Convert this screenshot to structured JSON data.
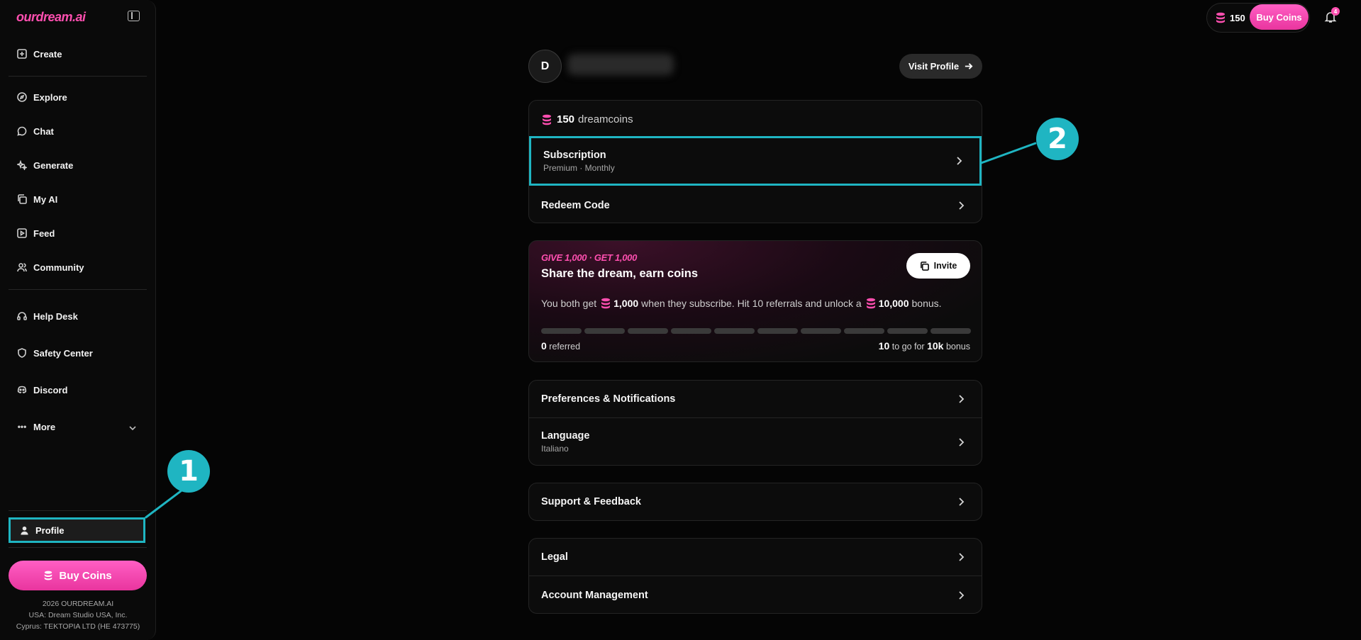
{
  "app": {
    "logo": "ourdream.ai"
  },
  "sidebar": {
    "items": [
      {
        "label": "Create"
      },
      {
        "label": "Explore"
      },
      {
        "label": "Chat"
      },
      {
        "label": "Generate"
      },
      {
        "label": "My AI"
      },
      {
        "label": "Feed"
      },
      {
        "label": "Community"
      },
      {
        "label": "Help Desk"
      },
      {
        "label": "Safety Center"
      },
      {
        "label": "Discord"
      },
      {
        "label": "More"
      }
    ],
    "profile_label": "Profile",
    "buy_coins_label": "Buy Coins",
    "footer": [
      "2026 OURDREAM.AI",
      "USA: Dream Studio USA, Inc.",
      "Cyprus: TEKTOPIA LTD (HE 473775)"
    ]
  },
  "topbar": {
    "coins": "150",
    "buy_coins_label": "Buy Coins",
    "notification_count": "4"
  },
  "profile": {
    "avatar_initial": "D",
    "visit_profile_label": "Visit Profile"
  },
  "account_card": {
    "coins_value": "150",
    "coins_unit": "dreamcoins",
    "subscription_title": "Subscription",
    "subscription_detail": "Premium · Monthly",
    "redeem_label": "Redeem Code"
  },
  "invite": {
    "promo": "GIVE 1,000 · GET 1,000",
    "title": "Share the dream, earn coins",
    "button_label": "Invite",
    "desc_1": "You both get",
    "amount_1": "1,000",
    "desc_2": "when they subscribe. Hit 10 referrals and unlock a",
    "amount_2": "10,000",
    "desc_3": "bonus.",
    "progress_done": 0,
    "progress_total": 10,
    "referred_count": "0",
    "referred_label": "referred",
    "to_go_count": "10",
    "to_go_label": "to go for",
    "bonus_amount": "10k",
    "bonus_label": "bonus"
  },
  "settings": {
    "preferences": "Preferences & Notifications",
    "language_title": "Language",
    "language_value": "Italiano",
    "support": "Support & Feedback",
    "legal": "Legal",
    "account_management": "Account Management"
  },
  "callouts": {
    "one": "1",
    "two": "2"
  },
  "colors": {
    "accent": "#ff4fb0",
    "highlight": "#1fb5c2",
    "background": "#050505"
  }
}
